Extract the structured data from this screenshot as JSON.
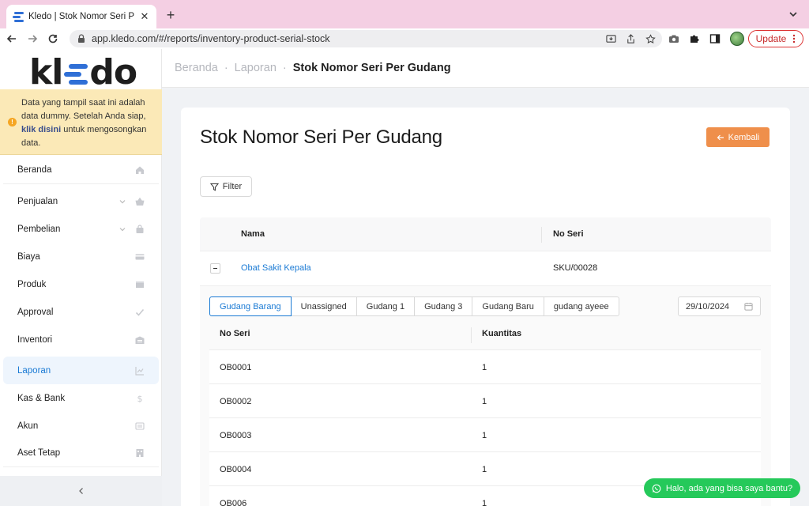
{
  "browser": {
    "tab_title": "Kledo | Stok Nomor Seri Per Gudang",
    "tab_close": "✕",
    "new_tab": "+",
    "url": "app.kledo.com/#/reports/inventory-product-serial-stock",
    "update_label": "Update"
  },
  "sidebar": {
    "logo_left": "kl",
    "logo_right": "do",
    "notice": {
      "text_1": "Data yang tampil saat ini adalah data dummy. Setelah Anda siap,",
      "link": "klik disini",
      "text_2": "untuk mengosongkan data."
    },
    "items": [
      {
        "label": "Beranda",
        "icon": "home-icon"
      },
      {
        "label": "Penjualan",
        "icon": "basket-icon"
      },
      {
        "label": "Pembelian",
        "icon": "bag-icon"
      },
      {
        "label": "Biaya",
        "icon": "card-icon"
      },
      {
        "label": "Produk",
        "icon": "box-icon"
      },
      {
        "label": "Approval",
        "icon": "check-icon"
      },
      {
        "label": "Inventori",
        "icon": "warehouse-icon"
      },
      {
        "label": "Laporan",
        "icon": "chart-icon"
      },
      {
        "label": "Kas & Bank",
        "icon": "dollar-icon"
      },
      {
        "label": "Akun",
        "icon": "list-icon"
      },
      {
        "label": "Aset Tetap",
        "icon": "building-icon"
      }
    ],
    "collapse": "<"
  },
  "breadcrumb": {
    "home": "Beranda",
    "reports": "Laporan",
    "current": "Stok Nomor Seri Per Gudang",
    "separator": "·"
  },
  "page": {
    "title": "Stok Nomor Seri Per Gudang",
    "back_label": "Kembali",
    "filter_label": "Filter"
  },
  "table": {
    "columns": [
      "Nama",
      "No Seri"
    ],
    "product": {
      "name": "Obat Sakit Kepala",
      "sku": "SKU/00028"
    }
  },
  "warehouses": {
    "tabs": [
      "Gudang Barang",
      "Unassigned",
      "Gudang 1",
      "Gudang 3",
      "Gudang Baru",
      "gudang ayeee"
    ],
    "active_index": 0,
    "date": "29/10/2024",
    "columns": [
      "No Seri",
      "Kuantitas"
    ],
    "rows": [
      {
        "serial": "OB0001",
        "qty": "1"
      },
      {
        "serial": "OB0002",
        "qty": "1"
      },
      {
        "serial": "OB0003",
        "qty": "1"
      },
      {
        "serial": "OB0004",
        "qty": "1"
      },
      {
        "serial": "OB006",
        "qty": "1"
      }
    ]
  },
  "chat": {
    "label": "Halo, ada yang bisa saya bantu?"
  },
  "colors": {
    "accent": "#1a7ad4",
    "back_button": "#ef8f4b",
    "notice_bg": "#fbe9b7",
    "chat": "#25c95a"
  }
}
